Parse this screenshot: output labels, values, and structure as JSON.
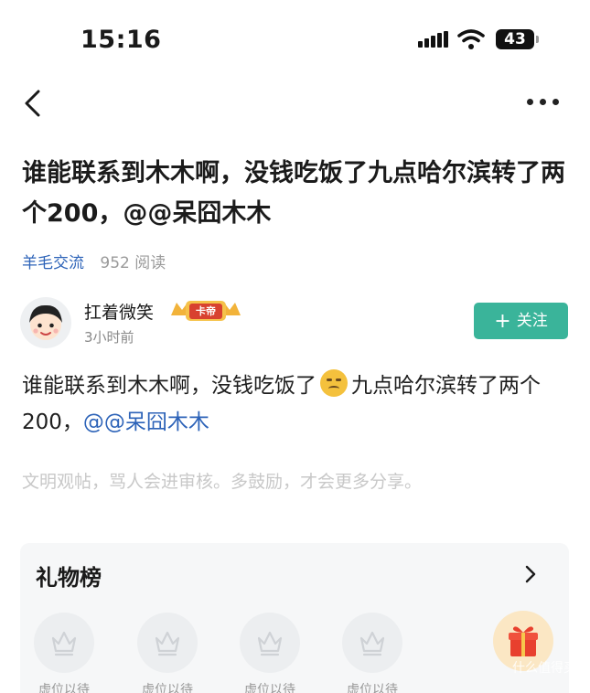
{
  "status_bar": {
    "time": "15:16",
    "battery": "43"
  },
  "post": {
    "title": "谁能联系到木木啊，没钱吃饭了九点哈尔滨转了两个200，@@呆囧木木",
    "tag": "羊毛交流",
    "views": "952 阅读",
    "body_text": "谁能联系到木木啊，没钱吃饭了",
    "body_text_2": "九点哈尔滨转了两个200，",
    "mention": "@@呆囧木木",
    "civility_note": "文明观帖，骂人会进审核。多鼓励，才会更多分享。"
  },
  "author": {
    "name": "扛着微笑",
    "badge": "卡帝",
    "time": "3小时前",
    "follow_label": "关注"
  },
  "gift_board": {
    "title": "礼物榜",
    "slots": [
      "虚位以待",
      "虚位以待",
      "虚位以待",
      "虚位以待"
    ]
  },
  "watermark": "什么值得买",
  "colors": {
    "accent_green": "#3ab49a",
    "link_blue": "#2d63b8",
    "badge_red": "#d8412f"
  },
  "icons": [
    "back-icon",
    "more-icon",
    "plus-icon",
    "crown-icon",
    "chevron-right-icon",
    "gift-icon",
    "emoji-icon",
    "wifi-icon",
    "signal-icon",
    "battery-icon"
  ]
}
